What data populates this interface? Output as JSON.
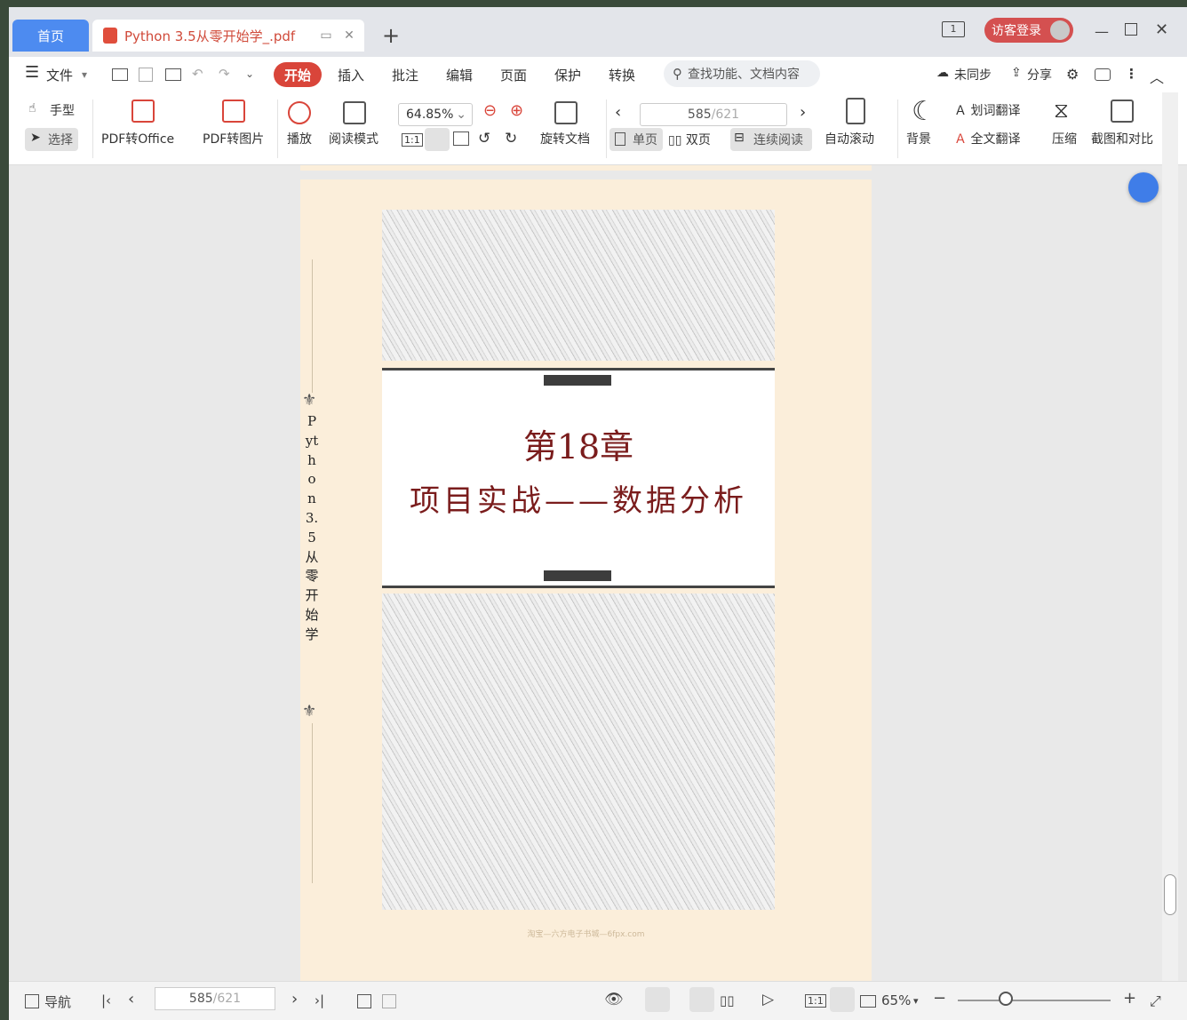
{
  "tabs": {
    "home": "首页",
    "document": "Python 3.5从零开始学_.pdf"
  },
  "titlebar": {
    "page_count_badge": "1",
    "login_label": "访客登录"
  },
  "menu": {
    "file": "文件",
    "items": [
      "开始",
      "插入",
      "批注",
      "编辑",
      "页面",
      "保护",
      "转换"
    ],
    "search_placeholder": "查找功能、文档内容",
    "sync": "未同步",
    "share": "分享"
  },
  "ribbon": {
    "hand": "手型",
    "select": "选择",
    "pdf_to_office": "PDF转Office",
    "pdf_to_image": "PDF转图片",
    "play": "播放",
    "read_mode": "阅读模式",
    "zoom": "64.85%",
    "rotate": "旋转文档",
    "page_current": "585",
    "page_total": "/621",
    "single": "单页",
    "double": "双页",
    "continuous": "连续阅读",
    "auto_scroll": "自动滚动",
    "background": "背景",
    "word_translate": "划词翻译",
    "full_translate": "全文翻译",
    "compress": "压缩",
    "screenshot_compare": "截图和对比",
    "fit_actual": "1:1"
  },
  "page": {
    "chapter_number": "第18章",
    "chapter_title": "项目实战——数据分析",
    "vertical_title": "Python 3.5从零开始学",
    "watermark": "淘宝—六方电子书城—6fpx.com"
  },
  "statusbar": {
    "nav": "导航",
    "page_current": "585",
    "page_total": "/621",
    "zoom": "65%",
    "fit_actual": "1:1"
  }
}
